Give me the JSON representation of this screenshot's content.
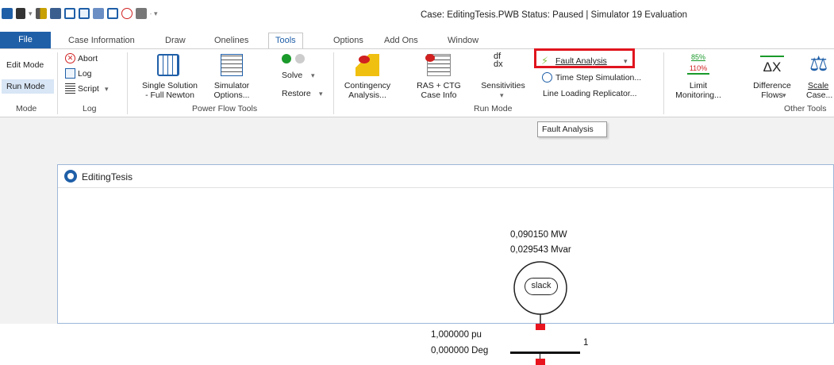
{
  "window": {
    "title": "Case: EditingTesis.PWB  Status: Paused | Simulator 19 Evaluation"
  },
  "tabs": [
    {
      "label": "File"
    },
    {
      "label": "Case Information"
    },
    {
      "label": "Draw"
    },
    {
      "label": "Onelines"
    },
    {
      "label": "Tools"
    },
    {
      "label": "Options"
    },
    {
      "label": "Add Ons"
    },
    {
      "label": "Window"
    }
  ],
  "ribbon": {
    "mode": {
      "edit": "Edit Mode",
      "run": "Run Mode",
      "group": "Mode"
    },
    "log": {
      "abort": "Abort",
      "log": "Log",
      "script": "Script",
      "group": "Log"
    },
    "power_flow": {
      "single_solution_1": "Single Solution",
      "single_solution_2": "- Full Newton",
      "simulator_options_1": "Simulator",
      "simulator_options_2": "Options...",
      "solve": "Solve",
      "restore": "Restore",
      "group": "Power Flow Tools"
    },
    "run_mode": {
      "contingency_1": "Contingency",
      "contingency_2": "Analysis...",
      "ras_1": "RAS + CTG",
      "ras_2": "Case Info",
      "sensitivities": "Sensitivities",
      "fault_analysis": "Fault Analysis",
      "time_step": "Time Step Simulation...",
      "line_loading": "Line Loading Replicator...",
      "group": "Run Mode"
    },
    "other": {
      "limit_pct_1": "85%",
      "limit_pct_2": "110%",
      "limit_1": "Limit",
      "limit_2": "Monitoring...",
      "diff_symbol": "ΔX",
      "diff_1": "Difference",
      "diff_2": "Flows",
      "scale_1": "Scale",
      "scale_2": "Case...",
      "group": "Other Tools"
    }
  },
  "tooltip": {
    "text": "Fault Analysis"
  },
  "document": {
    "title": "EditingTesis"
  },
  "oneline": {
    "mw": "0,090150 MW",
    "mvar": "0,029543 Mvar",
    "gen_label": "slack",
    "voltage": "1,000000 pu",
    "angle": "0,000000 Deg",
    "bus_number": "1"
  },
  "colors": {
    "accent": "#1f5fa8",
    "highlight_box": "#e0141e",
    "bus_red": "#e8141e"
  }
}
